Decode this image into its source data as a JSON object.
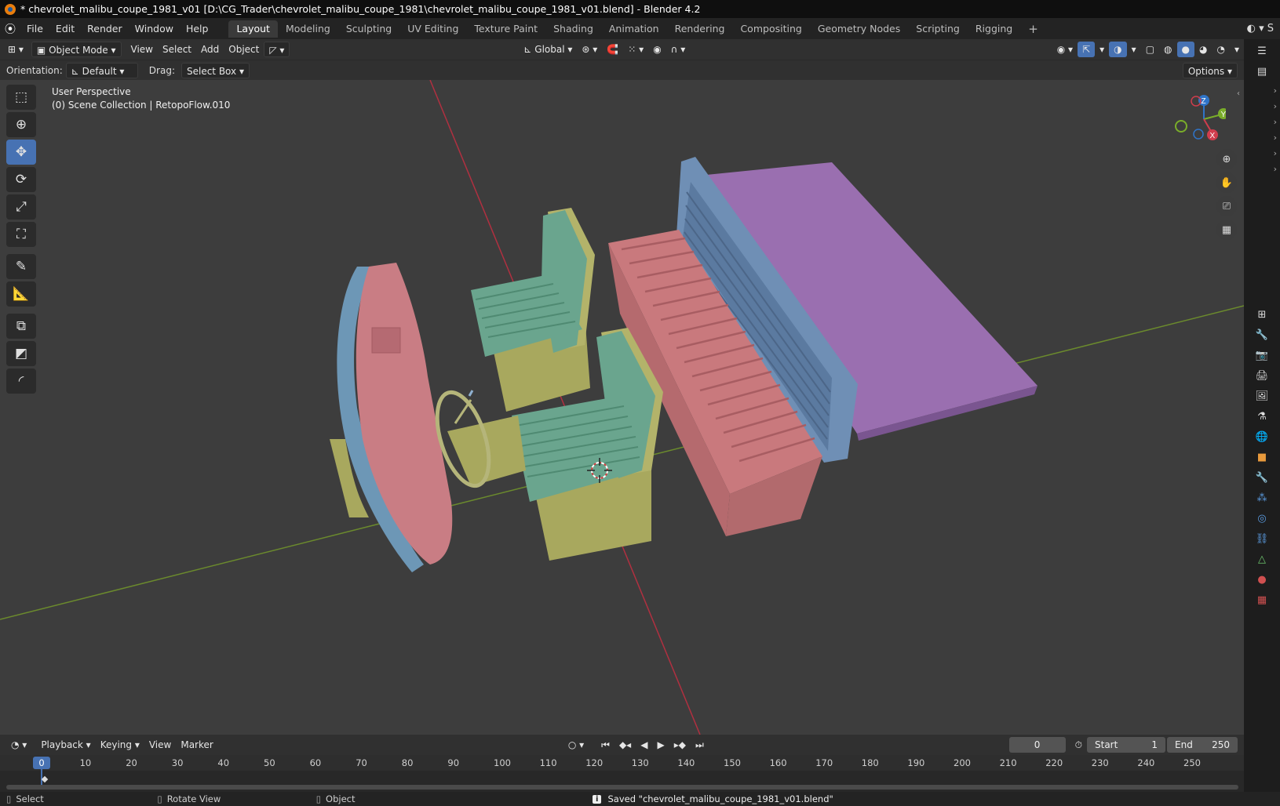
{
  "window": {
    "title": "* chevrolet_malibu_coupe_1981_v01 [D:\\CG_Trader\\chevrolet_malibu_coupe_1981\\chevrolet_malibu_coupe_1981_v01.blend] - Blender 4.2"
  },
  "menu": {
    "file": "File",
    "edit": "Edit",
    "render": "Render",
    "window": "Window",
    "help": "Help"
  },
  "workspaces": [
    {
      "label": "Layout",
      "active": true
    },
    {
      "label": "Modeling"
    },
    {
      "label": "Sculpting"
    },
    {
      "label": "UV Editing"
    },
    {
      "label": "Texture Paint"
    },
    {
      "label": "Shading"
    },
    {
      "label": "Animation"
    },
    {
      "label": "Rendering"
    },
    {
      "label": "Compositing"
    },
    {
      "label": "Geometry Nodes"
    },
    {
      "label": "Scripting"
    },
    {
      "label": "Rigging"
    }
  ],
  "viewport_header": {
    "mode": "Object Mode",
    "view": "View",
    "select": "Select",
    "add": "Add",
    "object": "Object",
    "transform": "Global"
  },
  "tool_header": {
    "orientation_label": "Orientation:",
    "orientation_value": "Default",
    "drag_label": "Drag:",
    "drag_value": "Select Box",
    "options": "Options"
  },
  "viewport": {
    "perspective": "User Perspective",
    "collection": "(0) Scene Collection | RetopoFlow.010",
    "gizmo": {
      "x": "X",
      "y": "Y",
      "z": "Z"
    }
  },
  "timeline_header": {
    "playback": "Playback",
    "keying": "Keying",
    "view": "View",
    "marker": "Marker",
    "current_frame": "0",
    "start_label": "Start",
    "start_value": "1",
    "end_label": "End",
    "end_value": "250"
  },
  "timeline": {
    "current": "0",
    "ticks": [
      "10",
      "20",
      "30",
      "40",
      "50",
      "60",
      "70",
      "80",
      "90",
      "100",
      "110",
      "120",
      "130",
      "140",
      "150",
      "160",
      "170",
      "180",
      "190",
      "200",
      "210",
      "220",
      "230",
      "240",
      "250"
    ]
  },
  "statusbar": {
    "select": "Select",
    "rotate": "Rotate View",
    "object": "Object",
    "message": "Saved \"chevrolet_malibu_coupe_1981_v01.blend\""
  },
  "colors": {
    "accent": "#4772b3",
    "dash": "#c97d84",
    "dash_trim": "#6d97b6",
    "seat_green": "#6aa58e",
    "seat_base": "#a8a85e",
    "rear_seat": "#c9797d",
    "rear_back": "#6f8fb5",
    "panel": "#9a6fb0"
  }
}
